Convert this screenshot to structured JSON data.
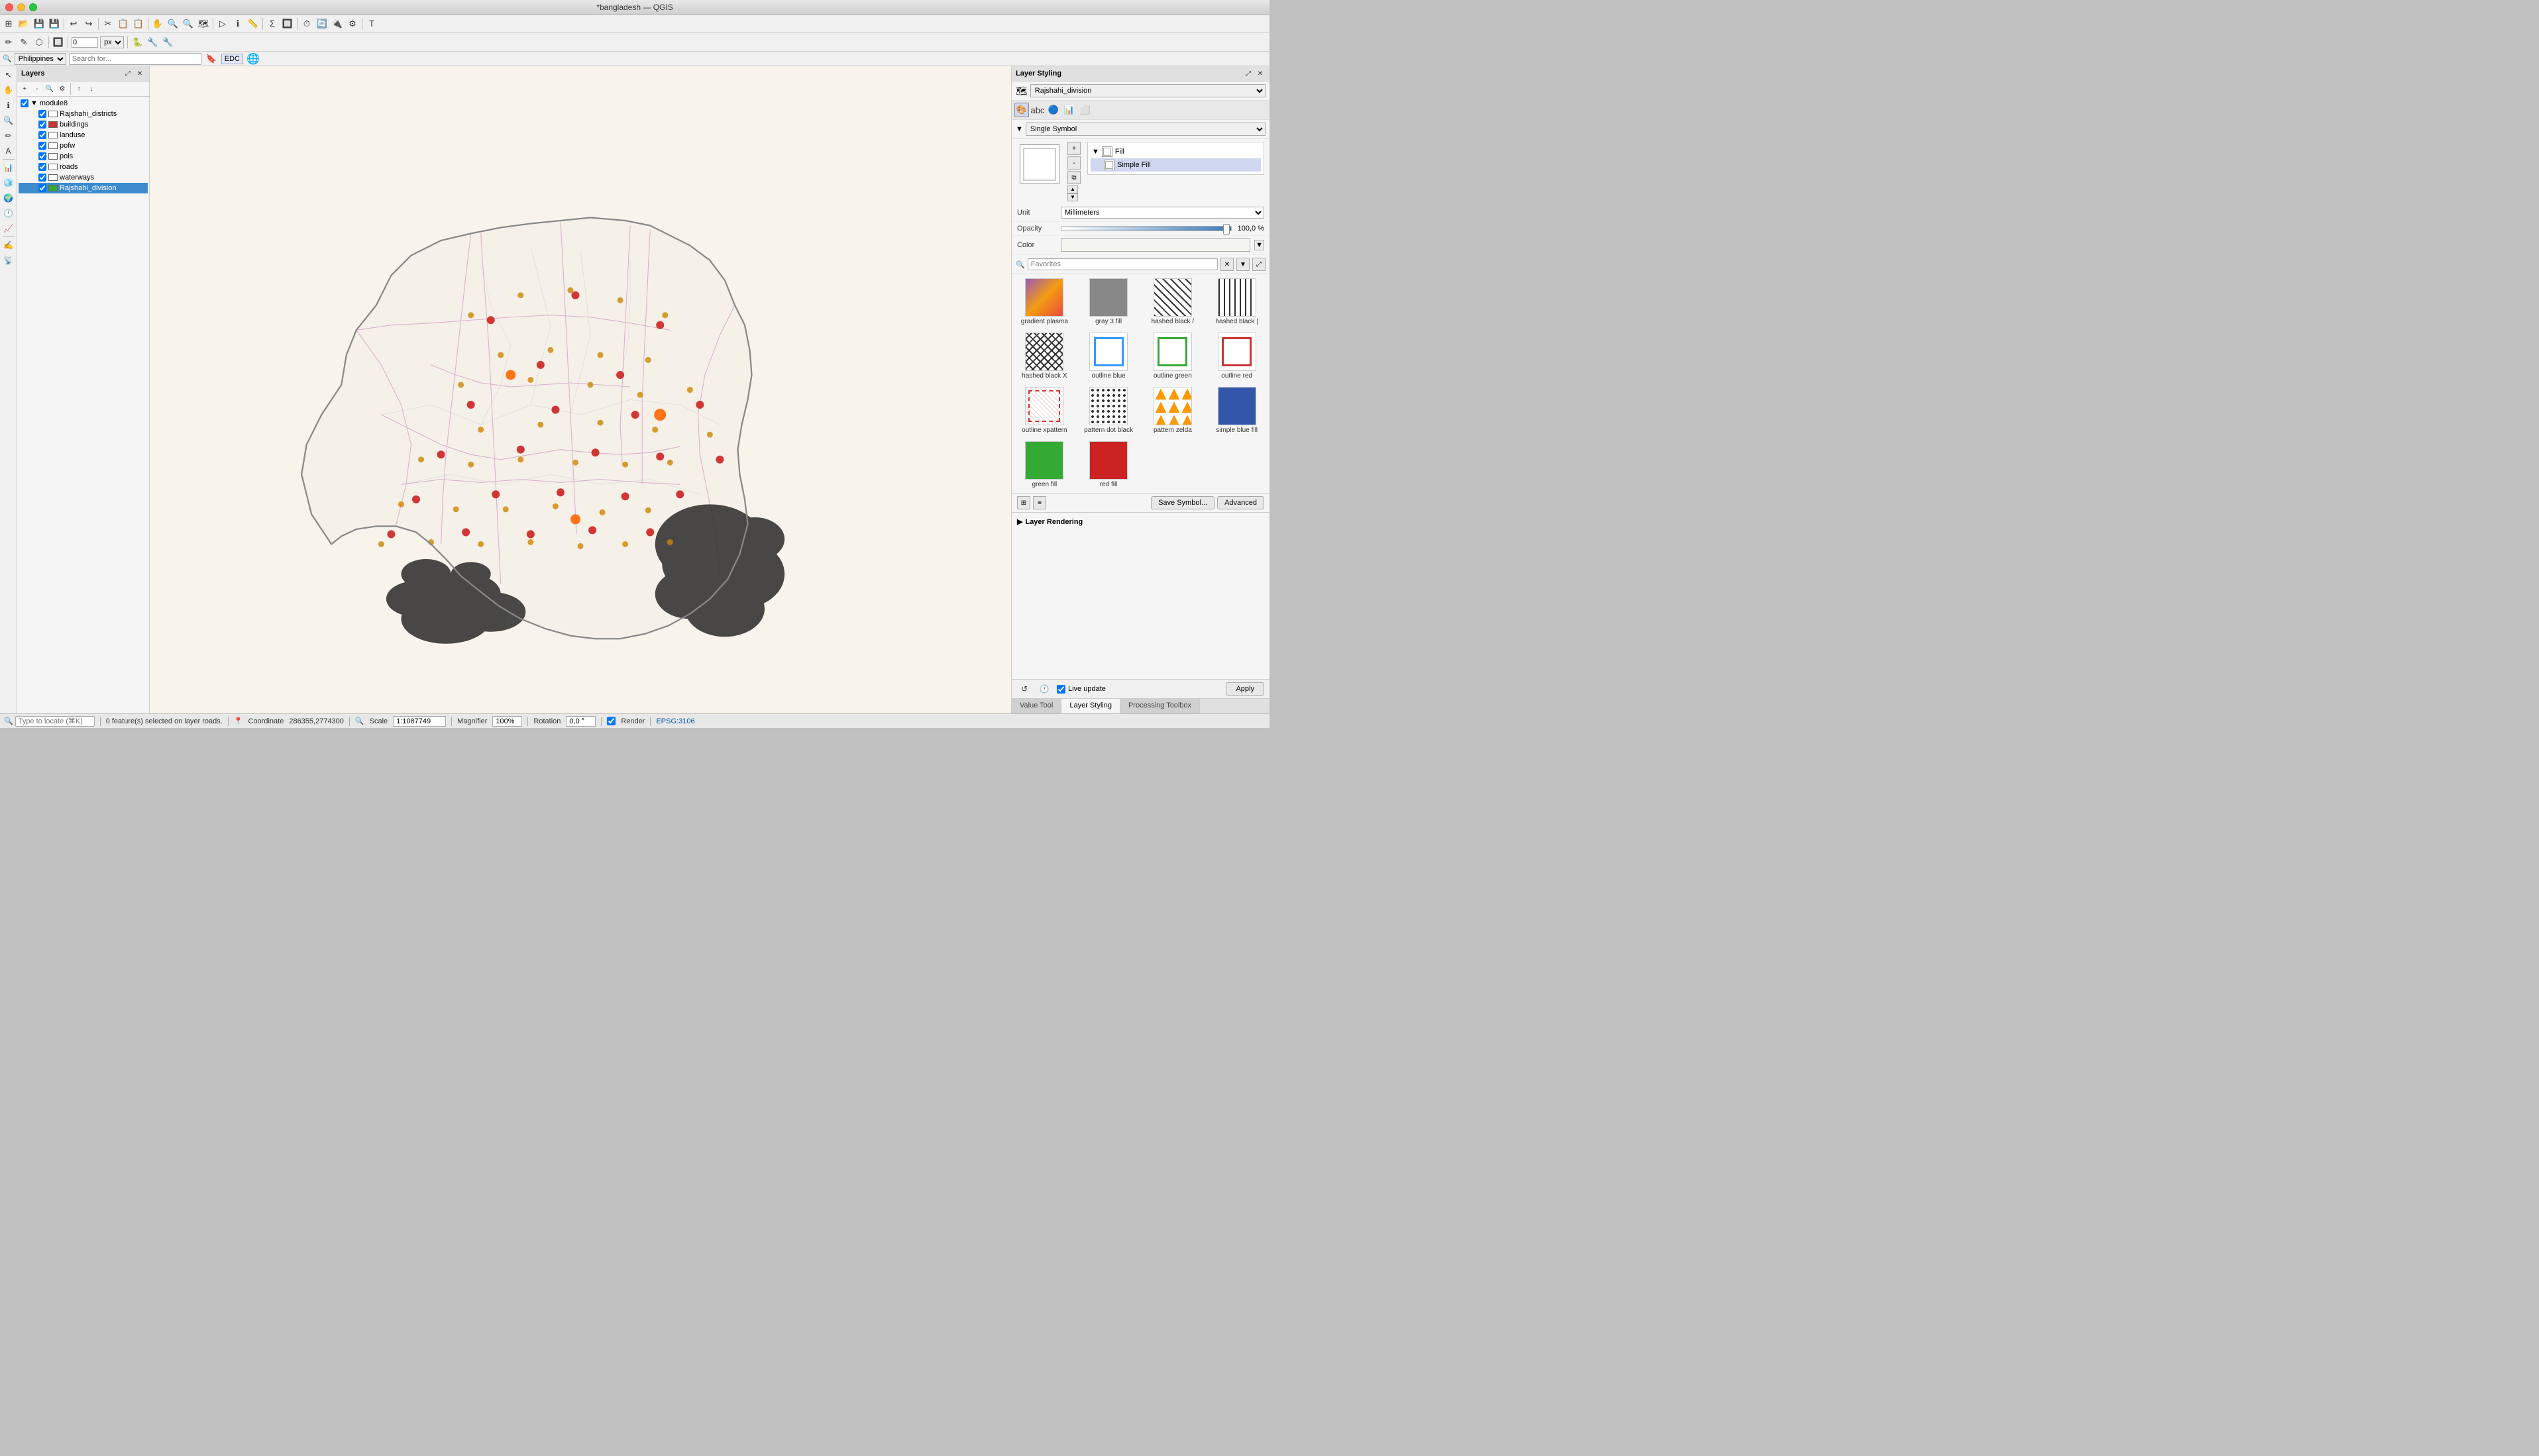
{
  "titlebar": {
    "title": "*bangladesh — QGIS"
  },
  "toolbars": {
    "toolbar1": {
      "buttons": [
        "⊞",
        "📁",
        "💾",
        "💾",
        "🖨",
        "↩",
        "↪",
        "✂",
        "📋",
        "📋",
        "🔍",
        "🔍",
        "🔍",
        "⚙",
        "📊",
        "Σ",
        "🔲",
        "🗺",
        "⏱",
        "🔄",
        "🔍",
        "📍",
        "🔲",
        "T",
        "📝"
      ]
    }
  },
  "locatebar": {
    "region": "Philippines",
    "search_placeholder": "Search for...",
    "edc_label": "EDC"
  },
  "layers_panel": {
    "title": "Layers",
    "group_name": "module8",
    "layers": [
      {
        "name": "Rajshahi_districts",
        "visible": true,
        "icon": "white",
        "selected": false
      },
      {
        "name": "buildings",
        "visible": true,
        "icon": "red",
        "selected": false
      },
      {
        "name": "landuse",
        "visible": true,
        "icon": "white",
        "selected": false
      },
      {
        "name": "pofw",
        "visible": true,
        "icon": "white",
        "selected": false
      },
      {
        "name": "pois",
        "visible": true,
        "icon": "white",
        "selected": false
      },
      {
        "name": "roads",
        "visible": true,
        "icon": "white",
        "selected": false
      },
      {
        "name": "waterways",
        "visible": true,
        "icon": "white",
        "selected": false
      },
      {
        "name": "Rajshahi_division",
        "visible": true,
        "icon": "green",
        "selected": true
      }
    ]
  },
  "right_panel": {
    "title": "Layer Styling",
    "layer_name": "Rajshahi_division",
    "symbol_type": "Single Symbol",
    "fill_label": "Fill",
    "simple_fill_label": "Simple Fill",
    "unit_label": "Unit",
    "unit_value": "Millimeters",
    "opacity_label": "Opacity",
    "opacity_value": "100,0 %",
    "color_label": "Color",
    "favorites_label": "Favorites",
    "symbols": [
      {
        "id": "gradient_plasma",
        "name": "gradient plasma",
        "type": "gradient"
      },
      {
        "id": "gray_3_fill",
        "name": "gray 3 fill",
        "type": "gray"
      },
      {
        "id": "hashed_black_fwd",
        "name": "hashed black /",
        "type": "hashed_fwd"
      },
      {
        "id": "hashed_black_bwd",
        "name": "hashed black |",
        "type": "hashed_bwd"
      },
      {
        "id": "hashed_black_x",
        "name": "hashed black X",
        "type": "hashed_x"
      },
      {
        "id": "outline_blue",
        "name": "outline blue",
        "type": "outline_blue"
      },
      {
        "id": "outline_green",
        "name": "outline green",
        "type": "outline_green"
      },
      {
        "id": "outline_red",
        "name": "outline red",
        "type": "outline_red"
      },
      {
        "id": "outline_xpattern",
        "name": "outline xpattern",
        "type": "outline_x"
      },
      {
        "id": "pattern_dot_black",
        "name": "pattern dot black",
        "type": "dot_black"
      },
      {
        "id": "pattern_zelda",
        "name": "pattern zelda",
        "type": "zelda"
      },
      {
        "id": "simple_blue_fill",
        "name": "simple blue fill",
        "type": "blue_fill"
      },
      {
        "id": "green_fill",
        "name": "green fill",
        "type": "green_fill"
      },
      {
        "id": "red_fill",
        "name": "red fill",
        "type": "red_fill"
      }
    ],
    "save_symbol_label": "Save Symbol...",
    "advanced_label": "Advanced",
    "layer_rendering_label": "Layer Rendering",
    "live_update_label": "Live update",
    "apply_label": "Apply"
  },
  "bottom_tabs": [
    {
      "id": "value_tool",
      "label": "Value Tool",
      "active": false
    },
    {
      "id": "layer_styling",
      "label": "Layer Styling",
      "active": true
    },
    {
      "id": "processing_toolbox",
      "label": "Processing Toolbox",
      "active": false
    }
  ],
  "statusbar": {
    "locate_placeholder": "Type to locate (⌘K)",
    "status_text": "0 feature(s) selected on layer roads.",
    "coordinate_label": "Coordinate",
    "coordinate_value": "286355,2774300",
    "scale_label": "Scale",
    "scale_value": "1:1087749",
    "magnifier_label": "Magnifier",
    "magnifier_value": "100%",
    "rotation_label": "Rotation",
    "rotation_value": "0,0 °",
    "render_label": "Render",
    "crs_value": "EPSG:3106"
  }
}
